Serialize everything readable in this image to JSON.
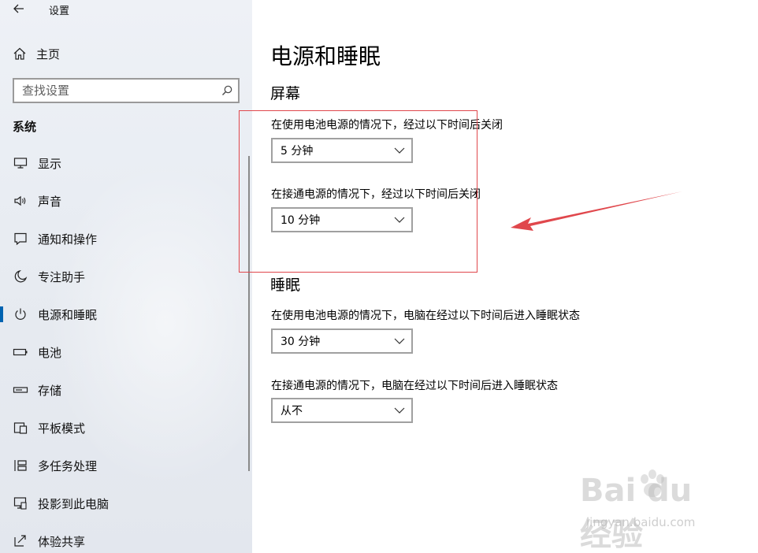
{
  "window": {
    "title": "设置"
  },
  "sidebar": {
    "home_label": "主页",
    "search_placeholder": "查找设置",
    "section_title": "系统",
    "items": [
      {
        "label": "显示",
        "icon": "monitor-icon"
      },
      {
        "label": "声音",
        "icon": "speaker-icon"
      },
      {
        "label": "通知和操作",
        "icon": "notification-icon"
      },
      {
        "label": "专注助手",
        "icon": "moon-icon"
      },
      {
        "label": "电源和睡眠",
        "icon": "power-icon",
        "active": true
      },
      {
        "label": "电池",
        "icon": "battery-icon"
      },
      {
        "label": "存储",
        "icon": "storage-icon"
      },
      {
        "label": "平板模式",
        "icon": "tablet-icon"
      },
      {
        "label": "多任务处理",
        "icon": "multitask-icon"
      },
      {
        "label": "投影到此电脑",
        "icon": "project-icon"
      },
      {
        "label": "体验共享",
        "icon": "share-icon"
      }
    ]
  },
  "main": {
    "page_title": "电源和睡眠",
    "screen": {
      "title": "屏幕",
      "battery_label": "在使用电池电源的情况下，经过以下时间后关闭",
      "battery_value": "5 分钟",
      "plugged_label": "在接通电源的情况下，经过以下时间后关闭",
      "plugged_value": "10 分钟"
    },
    "sleep": {
      "title": "睡眠",
      "battery_label": "在使用电池电源的情况下，电脑在经过以下时间后进入睡眠状态",
      "battery_value": "30 分钟",
      "plugged_label": "在接通电源的情况下，电脑在经过以下时间后进入睡眠状态",
      "plugged_value": "从不"
    }
  },
  "annotation": {
    "color": "#e0474c"
  },
  "accent_color": "#0063b1",
  "watermark": {
    "logo": "Bai du 经验",
    "url": "jingyan.baidu.com"
  }
}
